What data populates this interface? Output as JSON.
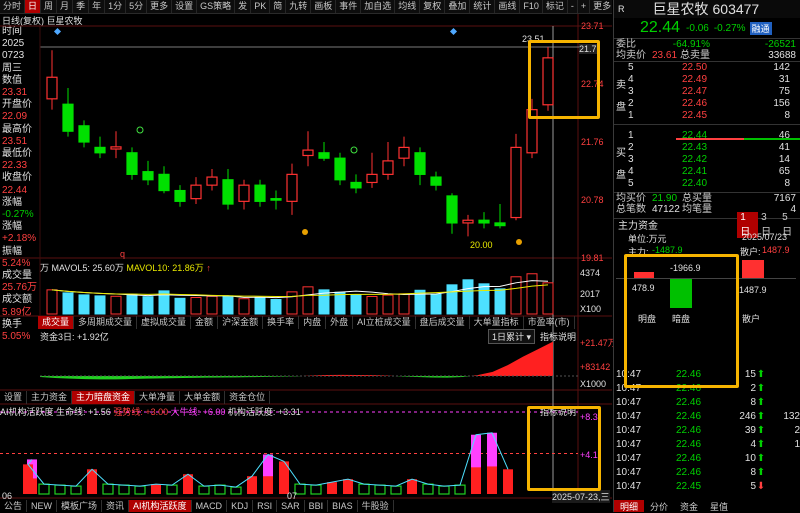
{
  "toolbar": {
    "tabs": [
      "分时",
      "日",
      "周",
      "月",
      "季",
      "年",
      "1分",
      "5分",
      "更多",
      "设置",
      "GS策略",
      "发",
      "PK",
      "简",
      "九转",
      "画板",
      "事件",
      "加自选",
      "均线",
      "复权",
      "叠加",
      "统计",
      "画线",
      "F10",
      "标记",
      "-",
      "+",
      "更多"
    ],
    "active_index": 1
  },
  "title": {
    "label": "日线(复权) 巨星农牧"
  },
  "info_panel": {
    "items": [
      {
        "k": "时间",
        "v": "2025"
      },
      {
        "k": "",
        "v": "0723"
      },
      {
        "k": "周三",
        "v": ""
      },
      {
        "k": "数值",
        "v": "23.31"
      },
      {
        "k": "开盘价",
        "v": "22.09"
      },
      {
        "k": "最高价",
        "v": "23.51"
      },
      {
        "k": "最低价",
        "v": "22.33"
      },
      {
        "k": "收盘价",
        "v": "22.44"
      },
      {
        "k": "涨幅",
        "v": "-0.27%"
      },
      {
        "k": "涨幅",
        "v": "+2.18%"
      },
      {
        "k": "振幅",
        "v": "5.24%"
      },
      {
        "k": "成交量",
        "v": "25.76万"
      },
      {
        "k": "成交额",
        "v": "5.89亿"
      },
      {
        "k": "换手",
        "v": "5.05%"
      }
    ]
  },
  "main_chart": {
    "y_ticks": [
      "23.71",
      "22.74",
      "21.76",
      "20.78",
      "19.81"
    ],
    "low_annotation": "20.00",
    "high_annotation": "23.51",
    "right_edge_marker": "21.7",
    "q_marker": "q"
  },
  "chart_data": {
    "type": "candlestick",
    "y_range": [
      19.6,
      23.9
    ],
    "candles": [
      {
        "o": 22.55,
        "c": 22.95,
        "h": 23.45,
        "l": 22.35
      },
      {
        "o": 22.45,
        "c": 21.95,
        "h": 22.75,
        "l": 21.85
      },
      {
        "o": 22.05,
        "c": 21.75,
        "h": 22.15,
        "l": 21.65
      },
      {
        "o": 21.65,
        "c": 21.55,
        "h": 21.85,
        "l": 21.45
      },
      {
        "o": 21.62,
        "c": 21.66,
        "h": 21.95,
        "l": 21.45
      },
      {
        "o": 21.55,
        "c": 21.15,
        "h": 21.65,
        "l": 21.05
      },
      {
        "o": 21.2,
        "c": 21.05,
        "h": 21.4,
        "l": 20.95
      },
      {
        "o": 21.15,
        "c": 20.85,
        "h": 21.3,
        "l": 20.8
      },
      {
        "o": 20.85,
        "c": 20.65,
        "h": 20.95,
        "l": 20.55
      },
      {
        "o": 20.7,
        "c": 20.95,
        "h": 21.1,
        "l": 20.6
      },
      {
        "o": 20.95,
        "c": 21.1,
        "h": 21.25,
        "l": 20.85
      },
      {
        "o": 21.05,
        "c": 20.6,
        "h": 21.25,
        "l": 20.5
      },
      {
        "o": 20.65,
        "c": 20.95,
        "h": 21.05,
        "l": 20.5
      },
      {
        "o": 20.95,
        "c": 20.65,
        "h": 21.05,
        "l": 20.55
      },
      {
        "o": 20.7,
        "c": 20.68,
        "h": 20.85,
        "l": 20.5
      },
      {
        "o": 20.65,
        "c": 21.15,
        "h": 21.35,
        "l": 20.4
      },
      {
        "o": 21.5,
        "c": 21.6,
        "h": 21.95,
        "l": 21.3
      },
      {
        "o": 21.55,
        "c": 21.45,
        "h": 21.75,
        "l": 21.4
      },
      {
        "o": 21.45,
        "c": 21.05,
        "h": 21.55,
        "l": 20.95
      },
      {
        "o": 21.0,
        "c": 20.9,
        "h": 21.15,
        "l": 20.8
      },
      {
        "o": 21.0,
        "c": 21.15,
        "h": 21.55,
        "l": 20.9
      },
      {
        "o": 21.15,
        "c": 21.4,
        "h": 21.75,
        "l": 21.05
      },
      {
        "o": 21.45,
        "c": 21.65,
        "h": 21.85,
        "l": 21.3
      },
      {
        "o": 21.55,
        "c": 21.15,
        "h": 21.65,
        "l": 20.95
      },
      {
        "o": 21.1,
        "c": 20.95,
        "h": 21.2,
        "l": 20.85
      },
      {
        "o": 20.75,
        "c": 20.25,
        "h": 20.8,
        "l": 20.05
      },
      {
        "o": 20.25,
        "c": 20.3,
        "h": 20.4,
        "l": 20.0
      },
      {
        "o": 20.3,
        "c": 20.25,
        "h": 20.45,
        "l": 20.15
      },
      {
        "o": 20.25,
        "c": 20.2,
        "h": 20.6,
        "l": 20.15
      },
      {
        "o": 20.35,
        "c": 21.65,
        "h": 21.9,
        "l": 20.3
      },
      {
        "o": 21.55,
        "c": 22.35,
        "h": 22.55,
        "l": 21.45
      },
      {
        "o": 22.44,
        "c": 23.31,
        "h": 23.51,
        "l": 22.33
      }
    ],
    "volumes": [
      {
        "v": 1200,
        "up": true
      },
      {
        "v": 1050,
        "up": false
      },
      {
        "v": 950,
        "up": false
      },
      {
        "v": 900,
        "up": false
      },
      {
        "v": 880,
        "up": true
      },
      {
        "v": 980,
        "up": false
      },
      {
        "v": 860,
        "up": false
      },
      {
        "v": 1150,
        "up": false
      },
      {
        "v": 780,
        "up": false
      },
      {
        "v": 820,
        "up": true
      },
      {
        "v": 880,
        "up": true
      },
      {
        "v": 900,
        "up": false
      },
      {
        "v": 760,
        "up": true
      },
      {
        "v": 820,
        "up": false
      },
      {
        "v": 720,
        "up": false
      },
      {
        "v": 1100,
        "up": true
      },
      {
        "v": 1350,
        "up": true
      },
      {
        "v": 1200,
        "up": false
      },
      {
        "v": 1080,
        "up": false
      },
      {
        "v": 950,
        "up": false
      },
      {
        "v": 870,
        "up": true
      },
      {
        "v": 940,
        "up": true
      },
      {
        "v": 1000,
        "up": true
      },
      {
        "v": 1180,
        "up": false
      },
      {
        "v": 980,
        "up": false
      },
      {
        "v": 1450,
        "up": false
      },
      {
        "v": 1700,
        "up": false
      },
      {
        "v": 1500,
        "up": false
      },
      {
        "v": 1250,
        "up": false
      },
      {
        "v": 1850,
        "up": true
      },
      {
        "v": 2000,
        "up": true
      },
      {
        "v": 1550,
        "up": true
      }
    ],
    "capital_flow": [
      -0.6,
      -1.2,
      -1.6,
      -1.9,
      -2.0,
      -2.0,
      -1.8,
      -1.6,
      -1.4,
      -1.3,
      -1.1,
      -1.0,
      -0.9,
      -0.8,
      -0.7,
      -0.5,
      -0.4,
      -0.2,
      0.3,
      0.6,
      0.7,
      0.6,
      0.5,
      0.3,
      -0.3,
      -0.6,
      -0.9,
      -1.0,
      -0.6,
      0.5,
      2.5,
      6.5,
      11.5,
      16.0,
      20.5
    ],
    "activity": [
      {
        "v": 3.5,
        "c": "magenta"
      },
      {
        "v": 3.0,
        "c": "red"
      },
      {
        "v": 1.0,
        "c": "green"
      },
      {
        "v": 0.9,
        "c": "green"
      },
      {
        "v": 0.8,
        "c": "green"
      },
      {
        "v": 2.5,
        "c": "red"
      },
      {
        "v": 1.0,
        "c": "green"
      },
      {
        "v": 0.9,
        "c": "green"
      },
      {
        "v": 0.8,
        "c": "green"
      },
      {
        "v": 1.0,
        "c": "red"
      },
      {
        "v": 0.9,
        "c": "green"
      },
      {
        "v": 2.0,
        "c": "red"
      },
      {
        "v": 0.8,
        "c": "green"
      },
      {
        "v": 0.9,
        "c": "green"
      },
      {
        "v": 0.7,
        "c": "green"
      },
      {
        "v": 1.8,
        "c": "red"
      },
      {
        "v": 4.0,
        "c": "magenta"
      },
      {
        "v": 3.3,
        "c": "red"
      },
      {
        "v": 1.0,
        "c": "green"
      },
      {
        "v": 0.9,
        "c": "green"
      },
      {
        "v": 1.2,
        "c": "red"
      },
      {
        "v": 1.5,
        "c": "red"
      },
      {
        "v": 1.0,
        "c": "green"
      },
      {
        "v": 0.9,
        "c": "green"
      },
      {
        "v": 0.8,
        "c": "green"
      },
      {
        "v": 1.5,
        "c": "red"
      },
      {
        "v": 1.0,
        "c": "green"
      },
      {
        "v": 0.8,
        "c": "green"
      },
      {
        "v": 0.9,
        "c": "green"
      },
      {
        "v": 6.0,
        "c": "magenta"
      },
      {
        "v": 6.2,
        "c": "magenta"
      },
      {
        "v": 2.5,
        "c": "red"
      }
    ]
  },
  "volume_pane": {
    "label_prefix": "万",
    "ma5": "MAVOL5: 25.60万",
    "ma10": "MAVOL10: 21.86万",
    "y_ticks": [
      "4374",
      "2017",
      "X100"
    ]
  },
  "indicator_tabs": {
    "items": [
      "成交量",
      "多周期成交量",
      "虚拟成交量",
      "金额",
      "沪深金额",
      "换手率",
      "内盘",
      "外盘",
      "AI立桩成交量",
      "盘后成交量",
      "大单量指标",
      "市盈率(市)"
    ],
    "selected": 0
  },
  "capital_pane": {
    "label": "资金3日: +1.92亿",
    "dropdown": "1日累计",
    "explain": "指标说明",
    "y_ticks": [
      "+21.47万",
      "+83142",
      "X1000"
    ]
  },
  "capital_tabs": {
    "items": [
      "设置",
      "主力资金",
      "主力暗盘资金",
      "大单净量",
      "大单金额",
      "资金仓位"
    ],
    "selected": 2
  },
  "activity_pane": {
    "title": "AI机构活跃度",
    "lifeline": "生命线: +1.56",
    "strong": "强势线: +3.00",
    "bull": "大牛线: +6.00",
    "active": "机构活跃度: +3.31",
    "explain": "指标说明",
    "y_ticks": [
      "+8.3",
      "+4.1"
    ],
    "x_labels": [
      "06",
      "07"
    ],
    "date_label": "2025-07-23,三"
  },
  "bottom_tabs": {
    "items": [
      "公告",
      "NEW",
      "模板广场",
      "资讯",
      "AI机构活跃度",
      "MACD",
      "KDJ",
      "RSI",
      "SAR",
      "BBI",
      "BIAS",
      "牛股验"
    ],
    "selected": 4
  },
  "quote": {
    "name": "巨星农牧",
    "code": "603477",
    "price": "22.44",
    "change": "-0.06",
    "pct": "-0.27%",
    "tag": "融通",
    "weibi_label": "委比",
    "weibi": "-64.91%",
    "weicha": "-26521",
    "avg_sell_label": "均卖价",
    "avg_sell": "23.61",
    "total_sell_label": "总卖量",
    "total_sell": "33688",
    "sells": [
      {
        "lvl": "5",
        "price": "22.50",
        "vol": "142",
        "pc": "red"
      },
      {
        "lvl": "4",
        "price": "22.49",
        "vol": "31",
        "pc": "red"
      },
      {
        "lvl": "3",
        "price": "22.47",
        "vol": "75",
        "pc": "red"
      },
      {
        "lvl": "2",
        "price": "22.46",
        "vol": "156",
        "pc": "red"
      },
      {
        "lvl": "1",
        "price": "22.45",
        "vol": "8",
        "pc": "red"
      }
    ],
    "buys": [
      {
        "lvl": "1",
        "price": "22.44",
        "vol": "46",
        "pc": "green"
      },
      {
        "lvl": "2",
        "price": "22.43",
        "vol": "41",
        "pc": "green"
      },
      {
        "lvl": "3",
        "price": "22.42",
        "vol": "14",
        "pc": "green"
      },
      {
        "lvl": "4",
        "price": "22.41",
        "vol": "65",
        "pc": "green"
      },
      {
        "lvl": "5",
        "price": "22.40",
        "vol": "8",
        "pc": "green"
      }
    ],
    "sell_side_label": "卖",
    "sell_side_label2": "盘",
    "buy_side_label": "买",
    "buy_side_label2": "盘",
    "avg_buy_label": "均买价",
    "avg_buy": "21.90",
    "total_buy_label": "总买量",
    "total_buy": "7167",
    "total_trades_label": "总笔数",
    "total_trades": "47122",
    "per_trade_label": "均笔量",
    "per_trade": "4"
  },
  "main_funds": {
    "title": "主力资金",
    "tabs": [
      "1日",
      "3日",
      "5日"
    ],
    "unit": "单位:万元",
    "date": "2025/07/23",
    "main_label": "主力:",
    "main_value": "-1487.9",
    "retail_label": "散户:",
    "retail_value": "1487.9",
    "bar_labels": [
      "478.9",
      "-1966.9",
      "1487.9"
    ],
    "cat_labels": [
      "明盘",
      "暗盘",
      "散户"
    ]
  },
  "ticks": [
    {
      "t": "10:47",
      "p": "22.46",
      "v": "15",
      "d": "up"
    },
    {
      "t": "10:47",
      "p": "22.46",
      "v": "2",
      "d": "up"
    },
    {
      "t": "10:47",
      "p": "22.46",
      "v": "8",
      "d": "up"
    },
    {
      "t": "10:47",
      "p": "22.46",
      "v": "246",
      "d": "up",
      "n": "132"
    },
    {
      "t": "10:47",
      "p": "22.46",
      "v": "39",
      "d": "up",
      "n": "2"
    },
    {
      "t": "10:47",
      "p": "22.46",
      "v": "4",
      "d": "up",
      "n": "1"
    },
    {
      "t": "10:47",
      "p": "22.46",
      "v": "10",
      "d": "up"
    },
    {
      "t": "10:47",
      "p": "22.46",
      "v": "8",
      "d": "up"
    },
    {
      "t": "10:47",
      "p": "22.45",
      "v": "5",
      "d": "down"
    }
  ],
  "right_bottom_tabs": [
    "明细",
    "分价",
    "资金",
    "星值"
  ]
}
